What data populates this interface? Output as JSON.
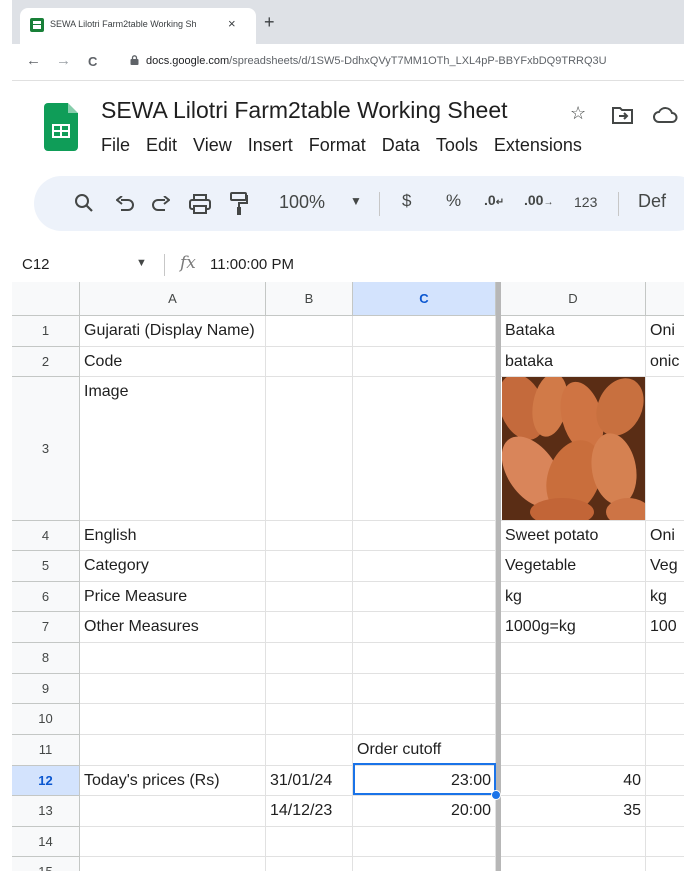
{
  "browser": {
    "tab_title": "SEWA Lilotri Farm2table Working Sh",
    "tab_close": "×",
    "new_tab": "+",
    "back": "←",
    "forward": "→",
    "reload": "C",
    "url_host": "docs.google.com",
    "url_path": "/spreadsheets/d/1SW5-DdhxQVyT7MM1OTh_LXL4pP-BBYFxbDQ9TRRQ3U"
  },
  "doc": {
    "title": "SEWA Lilotri Farm2table Working Sheet",
    "icons": [
      "star-icon",
      "move-to-folder-icon",
      "cloud-status-icon"
    ],
    "menu": [
      "File",
      "Edit",
      "View",
      "Insert",
      "Format",
      "Data",
      "Tools",
      "Extensions"
    ]
  },
  "toolbar": {
    "zoom": "100%",
    "currency": "$",
    "percent": "%",
    "decrease_decimal": ".0",
    "increase_decimal": ".00",
    "number_format": "123",
    "default_font": "Def",
    "icons": [
      "search-icon",
      "undo-icon",
      "redo-icon",
      "print-icon",
      "paint-format-icon",
      "dropdown-arrow-icon"
    ]
  },
  "formula_bar": {
    "name_box": "C12",
    "fx": "fx",
    "value": "11:00:00 PM"
  },
  "grid": {
    "columns": [
      "A",
      "B",
      "C",
      "D",
      ""
    ],
    "selected_column": "C",
    "selected_row": "12",
    "rows": [
      {
        "n": "1",
        "a": "Gujarati (Display Name)",
        "b": "",
        "c": "",
        "d": "Bataka",
        "e": "Oni"
      },
      {
        "n": "2",
        "a": "Code",
        "b": "",
        "c": "",
        "d": "bataka",
        "e": "onic"
      },
      {
        "n": "3",
        "a": "Image",
        "b": "",
        "c": "",
        "d": "",
        "e": ""
      },
      {
        "n": "4",
        "a": "English",
        "b": "",
        "c": "",
        "d": "Sweet potato",
        "e": "Oni"
      },
      {
        "n": "5",
        "a": "Category",
        "b": "",
        "c": "",
        "d": "Vegetable",
        "e": "Veg"
      },
      {
        "n": "6",
        "a": "Price Measure",
        "b": "",
        "c": "",
        "d": "kg",
        "e": "kg"
      },
      {
        "n": "7",
        "a": "Other Measures",
        "b": "",
        "c": "",
        "d": "1000g=kg",
        "e": "100"
      },
      {
        "n": "8",
        "a": "",
        "b": "",
        "c": "",
        "d": "",
        "e": ""
      },
      {
        "n": "9",
        "a": "",
        "b": "",
        "c": "",
        "d": "",
        "e": ""
      },
      {
        "n": "10",
        "a": "",
        "b": "",
        "c": "",
        "d": "",
        "e": ""
      },
      {
        "n": "11",
        "a": "",
        "b": "",
        "c": "Order cutoff",
        "d": "",
        "e": ""
      },
      {
        "n": "12",
        "a": "Today's prices (Rs)",
        "b": "31/01/24",
        "c": "23:00",
        "d": "40",
        "e": ""
      },
      {
        "n": "13",
        "a": "",
        "b": "14/12/23",
        "c": "20:00",
        "d": "35",
        "e": ""
      },
      {
        "n": "14",
        "a": "",
        "b": "",
        "c": "",
        "d": "",
        "e": ""
      },
      {
        "n": "15",
        "a": "",
        "b": "",
        "c": "",
        "d": "",
        "e": ""
      }
    ]
  }
}
